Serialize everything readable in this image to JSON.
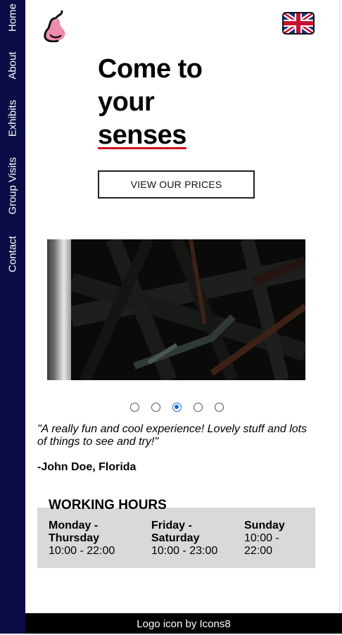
{
  "sidebar": {
    "items": [
      {
        "label": "Home"
      },
      {
        "label": "About"
      },
      {
        "label": "Exhibits"
      },
      {
        "label": "Group Visits"
      },
      {
        "label": "Contact"
      }
    ]
  },
  "header": {
    "logo_icon": "pear-logo-icon",
    "language_icon": "uk-flag-icon"
  },
  "hero": {
    "line1": "Come to",
    "line2": "your",
    "line3": "senses",
    "accent_color": "#d1101c",
    "button_label": "VIEW OUR PRICES"
  },
  "carousel": {
    "slide_count": 5,
    "active_index": 2,
    "accent_color": "#1a64d6"
  },
  "testimonial": {
    "quote": "\"A really fun and cool experience! Lovely stuff and lots of things to see and try!\"",
    "author": "-John Doe, Florida"
  },
  "hours": {
    "title": "WORKING HOURS",
    "columns": [
      {
        "days": "Monday - Thursday",
        "time": "10:00 - 22:00"
      },
      {
        "days": "Friday - Saturday",
        "time": "10:00 - 23:00"
      },
      {
        "days": "Sunday",
        "time": "10:00 - 22:00"
      }
    ]
  },
  "footer": {
    "text": "Logo icon by Icons8"
  },
  "colors": {
    "sidebar": "#0b0c45",
    "hours_bg": "#d9d9d9",
    "footer_bg": "#000000"
  }
}
